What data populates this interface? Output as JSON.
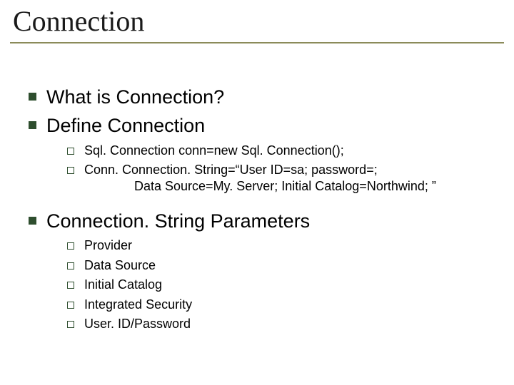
{
  "title": "Connection",
  "bullets": {
    "b1": "What is Connection?",
    "b2": "Define Connection",
    "b2_sub": {
      "s1": "Sql. Connection conn=new Sql. Connection();",
      "s2_a": "Conn. Connection. String=“User ID=sa; password=;",
      "s2_b": "Data Source=My. Server; Initial Catalog=Northwind; ”"
    },
    "b3": "Connection. String Parameters",
    "b3_sub": {
      "s1": "Provider",
      "s2": "Data Source",
      "s3": "Initial Catalog",
      "s4": "Integrated Security",
      "s5": "User. ID/Password"
    }
  }
}
